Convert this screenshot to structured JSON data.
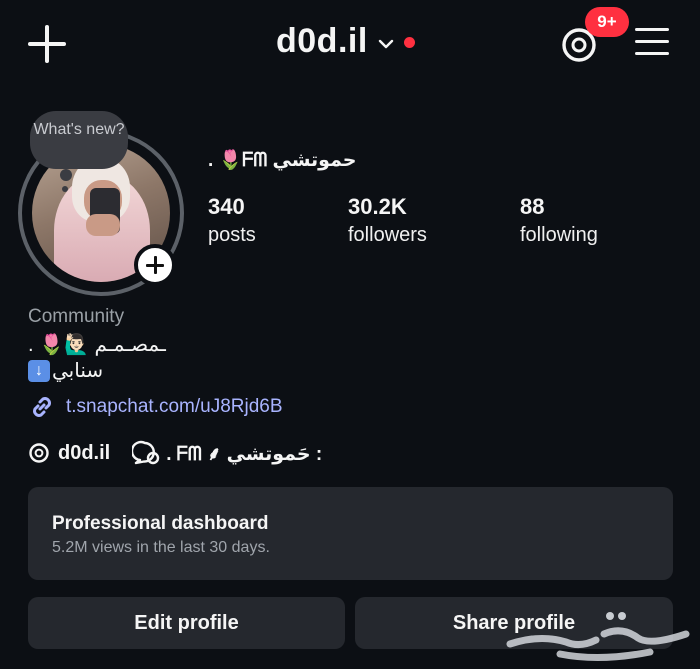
{
  "header": {
    "username": "d0d.il",
    "notification_count": "9+"
  },
  "profile": {
    "story_bubble": "What's new?",
    "display_name": ". 🌷ᖴᗰ    حموتشي",
    "stats": [
      {
        "value": "340",
        "label": "posts"
      },
      {
        "value": "30.2K",
        "label": "followers"
      },
      {
        "value": "88",
        "label": "following"
      }
    ],
    "category": "Community",
    "bio_line1": "ـمصـمـم 🙋🏻‍♂️🌷 .",
    "bio_line2": "سنابي",
    "link": "t.snapchat.com/uJ8Rjd6B",
    "threads_handle": "d0d.il",
    "channel_name": ". ᖴᗰ ⸙ حَموتشي :"
  },
  "dashboard": {
    "title": "Professional dashboard",
    "subtitle": "5.2M views in the last 30 days."
  },
  "actions": {
    "edit_label": "Edit profile",
    "share_label": "Share profile"
  },
  "colors": {
    "background": "#0c0f14",
    "card": "#25282e",
    "badge_red": "#ff3040",
    "link_blue": "#a9b4ff"
  }
}
